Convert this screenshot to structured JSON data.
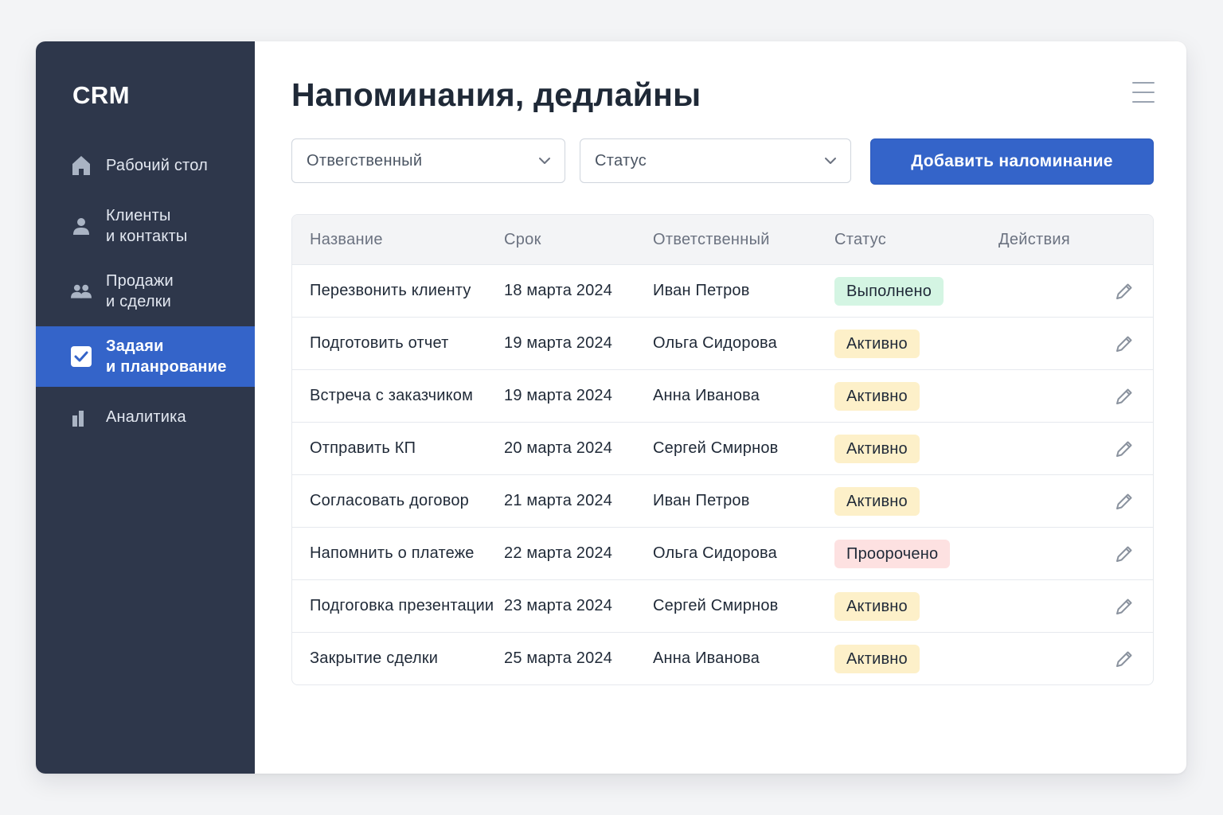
{
  "sidebar": {
    "brand": "CRM",
    "items": [
      {
        "label_line1": "Рабочий стол",
        "label_line2": "",
        "icon": "home-icon",
        "active": false
      },
      {
        "label_line1": "Клиенты",
        "label_line2": "и контакты",
        "icon": "user-icon",
        "active": false
      },
      {
        "label_line1": "Продажи",
        "label_line2": "и сделки",
        "icon": "users-icon",
        "active": false
      },
      {
        "label_line1": "Задаяи",
        "label_line2": "и планрование",
        "icon": "checkbox-icon",
        "active": true
      },
      {
        "label_line1": "Аналитика",
        "label_line2": "",
        "icon": "bar-chart-icon",
        "active": false
      }
    ]
  },
  "header": {
    "title": "Напоминания, дедлайны",
    "menu_icon": "hamburger-menu-icon"
  },
  "filters": {
    "responsible": {
      "value": "Отвегственный"
    },
    "status": {
      "value": "Статус"
    },
    "add_button_label": "Добавить наломинание"
  },
  "table": {
    "columns": [
      "Название",
      "Срок",
      "Ответственный",
      "Статус",
      "Действия"
    ],
    "rows": [
      {
        "name": "Перезвонить клиенту",
        "due": "18 марта 2024",
        "owner": "Иван Петров",
        "status": "Выполнено",
        "status_kind": "done"
      },
      {
        "name": "Подготовить отчет",
        "due": "19 марта 2024",
        "owner": "Ольга Сидорова",
        "status": "Активно",
        "status_kind": "active"
      },
      {
        "name": "Встреча с заказчиком",
        "due": "19 марта 2024",
        "owner": "Анна Иванова",
        "status": "Активно",
        "status_kind": "active"
      },
      {
        "name": "Отправить КП",
        "due": "20 марта 2024",
        "owner": "Сергей Смирнов",
        "status": "Активно",
        "status_kind": "active"
      },
      {
        "name": "Согласовать договор",
        "due": "21 марта 2024",
        "owner": "Иван Петров",
        "status": "Активно",
        "status_kind": "active"
      },
      {
        "name": "Напомнить о платеже",
        "due": "22 марта 2024",
        "owner": "Ольга Сидорова",
        "status": "Проорочено",
        "status_kind": "overdue"
      },
      {
        "name": "Подгоговка презентации",
        "due": "23 марта 2024",
        "owner": "Сергей Смирнов",
        "status": "Активно",
        "status_kind": "active"
      },
      {
        "name": "Закрытие сделки",
        "due": "25 марта 2024",
        "owner": "Анна Иванова",
        "status": "Активно",
        "status_kind": "active"
      }
    ]
  },
  "colors": {
    "sidebar_bg": "#2e374b",
    "accent": "#3464c9",
    "status_done": "#d4f5e3",
    "status_active": "#fdf0c9",
    "status_overdue": "#fde1e1"
  }
}
